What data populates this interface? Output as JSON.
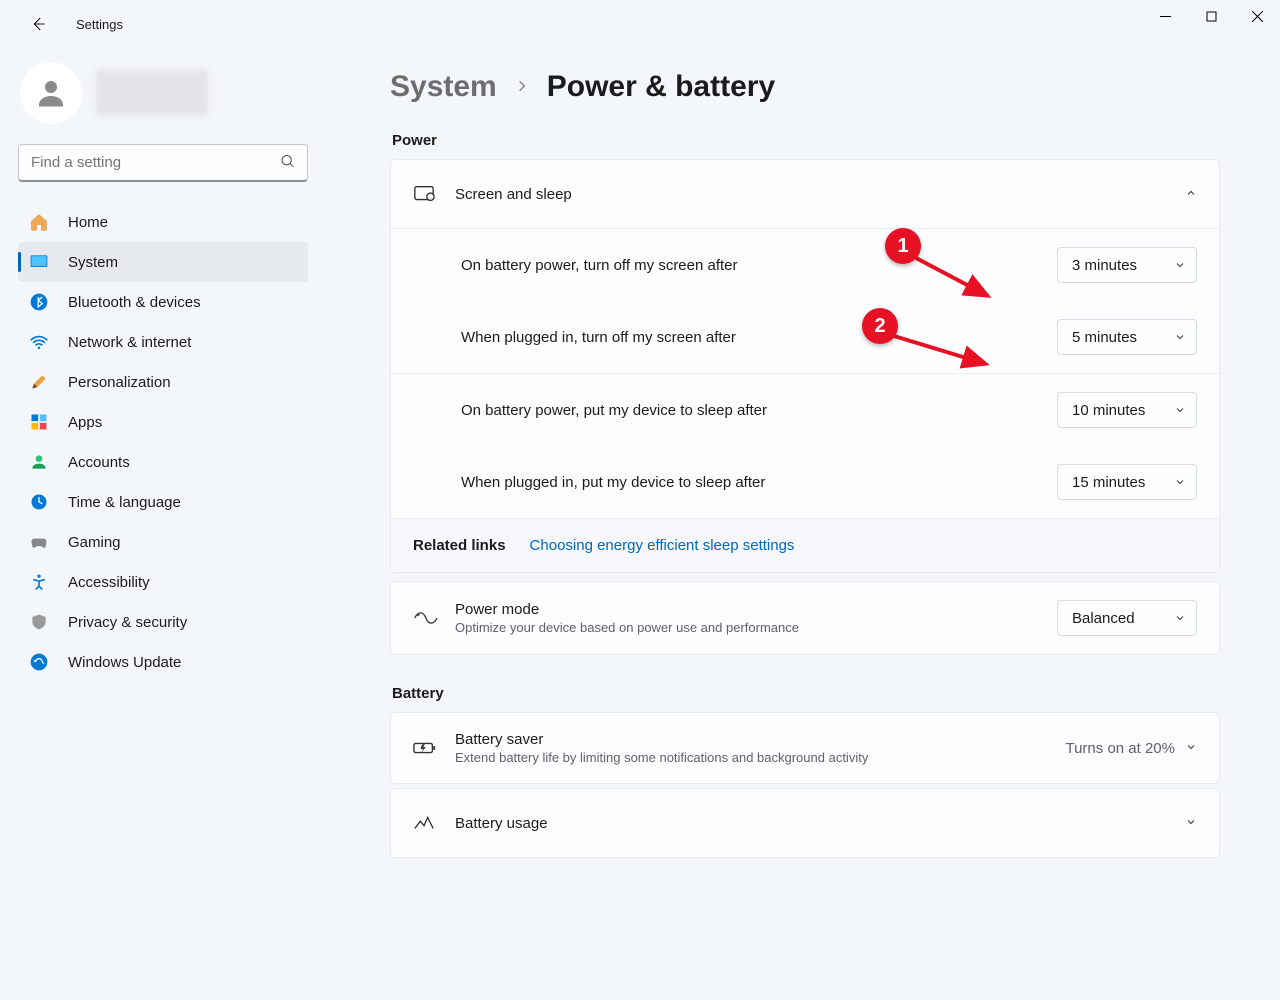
{
  "app": {
    "title": "Settings"
  },
  "search": {
    "placeholder": "Find a setting"
  },
  "nav": {
    "items": [
      {
        "label": "Home"
      },
      {
        "label": "System"
      },
      {
        "label": "Bluetooth & devices"
      },
      {
        "label": "Network & internet"
      },
      {
        "label": "Personalization"
      },
      {
        "label": "Apps"
      },
      {
        "label": "Accounts"
      },
      {
        "label": "Time & language"
      },
      {
        "label": "Gaming"
      },
      {
        "label": "Accessibility"
      },
      {
        "label": "Privacy & security"
      },
      {
        "label": "Windows Update"
      }
    ]
  },
  "breadcrumb": {
    "parent": "System",
    "current": "Power & battery"
  },
  "sections": {
    "power": "Power",
    "battery": "Battery"
  },
  "screen_sleep": {
    "title": "Screen and sleep",
    "battery_screen_label": "On battery power, turn off my screen after",
    "battery_screen_value": "3 minutes",
    "plugged_screen_label": "When plugged in, turn off my screen after",
    "plugged_screen_value": "5 minutes",
    "battery_sleep_label": "On battery power, put my device to sleep after",
    "battery_sleep_value": "10 minutes",
    "plugged_sleep_label": "When plugged in, put my device to sleep after",
    "plugged_sleep_value": "15 minutes"
  },
  "related": {
    "label": "Related links",
    "link": "Choosing energy efficient sleep settings"
  },
  "power_mode": {
    "title": "Power mode",
    "subtitle": "Optimize your device based on power use and performance",
    "value": "Balanced"
  },
  "battery_saver": {
    "title": "Battery saver",
    "subtitle": "Extend battery life by limiting some notifications and background activity",
    "status": "Turns on at 20%"
  },
  "battery_usage": {
    "title": "Battery usage"
  },
  "callouts": {
    "c1": "1",
    "c2": "2"
  }
}
